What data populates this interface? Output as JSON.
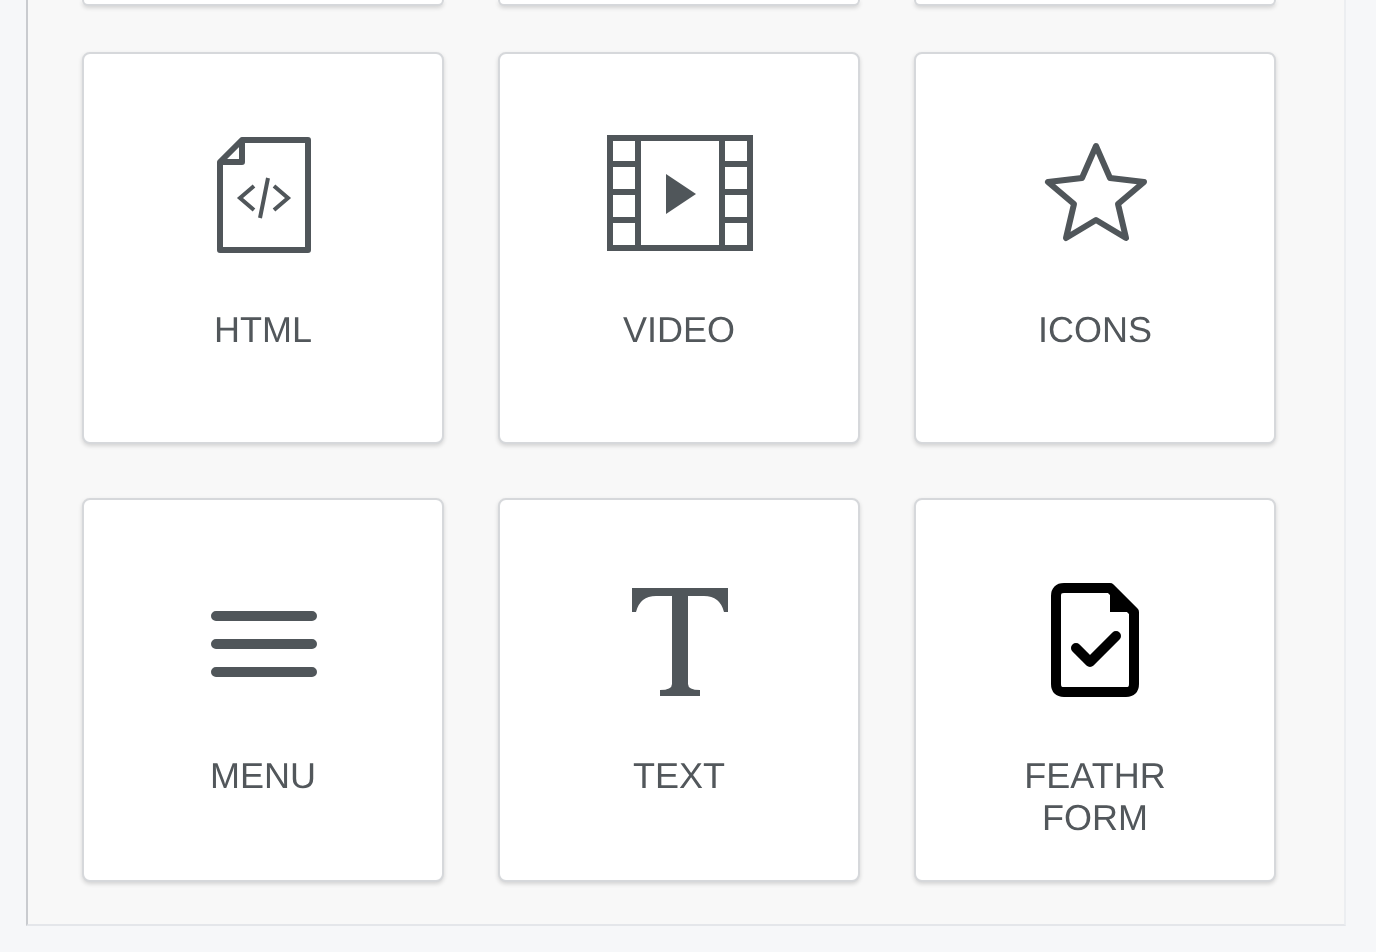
{
  "tiles": [
    {
      "kind": "cut"
    },
    {
      "kind": "cut"
    },
    {
      "kind": "cut"
    },
    {
      "kind": "html",
      "label": "HTML"
    },
    {
      "kind": "video",
      "label": "VIDEO"
    },
    {
      "kind": "star",
      "label": "ICONS"
    },
    {
      "kind": "menu",
      "label": "MENU"
    },
    {
      "kind": "text",
      "label": "TEXT"
    },
    {
      "kind": "form",
      "label": "FEATHR FORM"
    }
  ]
}
